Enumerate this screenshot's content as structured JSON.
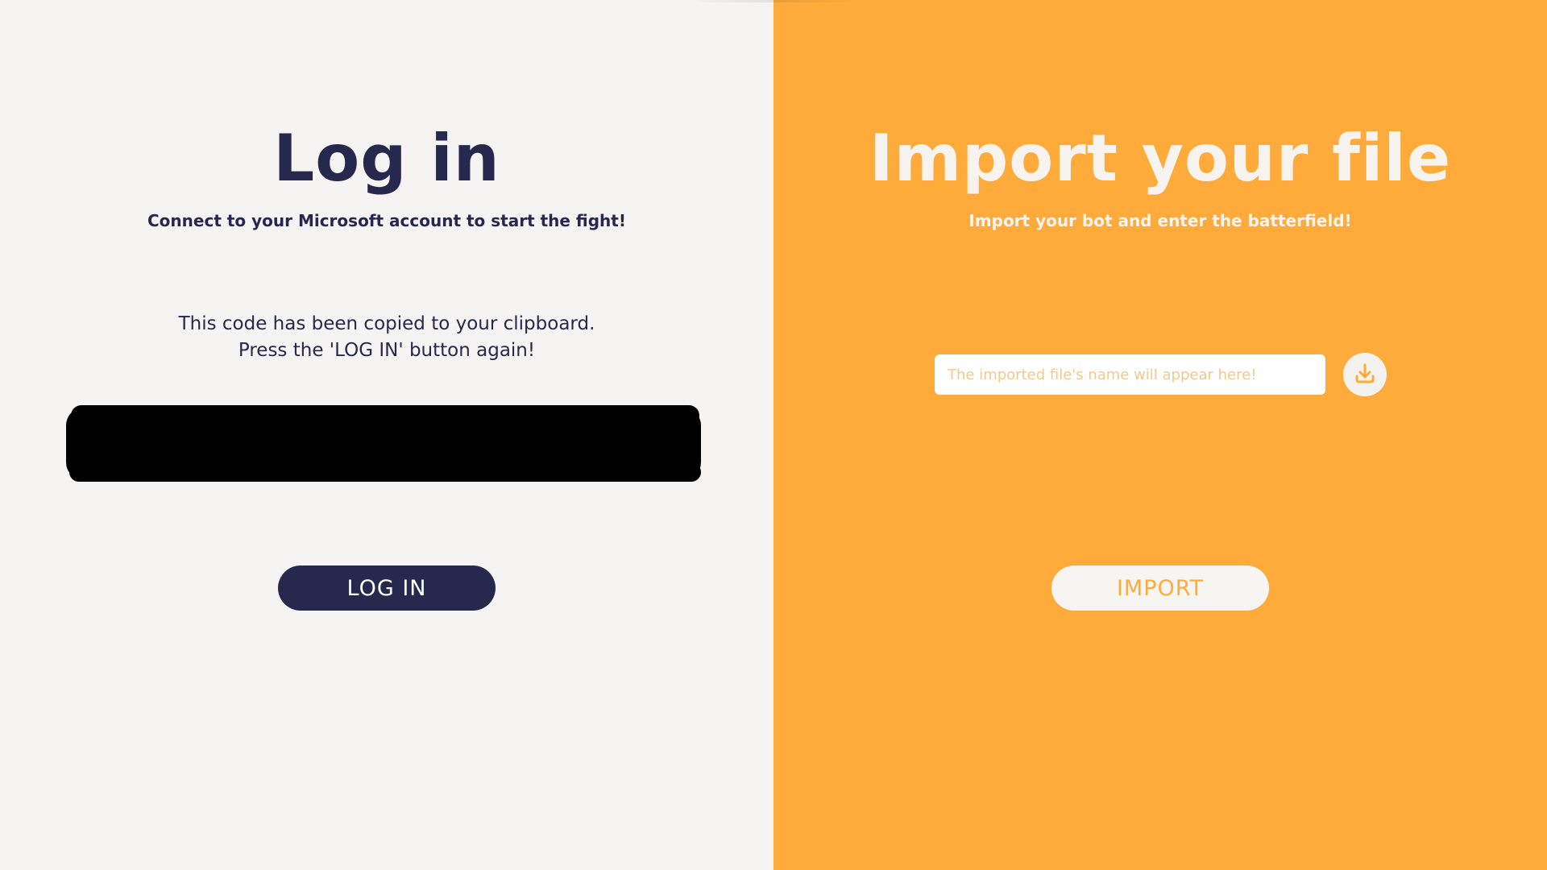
{
  "login_panel": {
    "title": "Log in",
    "subtitle": "Connect to your Microsoft account to start the fight!",
    "info_line_1": "This code has been copied to your clipboard.",
    "info_line_2": "Press the 'LOG IN' button again!",
    "button_label": "LOG IN"
  },
  "import_panel": {
    "title": "Import your file",
    "subtitle": "Import your bot and enter the batterfield!",
    "file_name_placeholder": "The imported file's name will appear here!",
    "browse_icon": "download-icon",
    "button_label": "IMPORT"
  },
  "colors": {
    "navy": "#26284d",
    "orange": "#ffab3b",
    "light": "#f5f4f2"
  }
}
